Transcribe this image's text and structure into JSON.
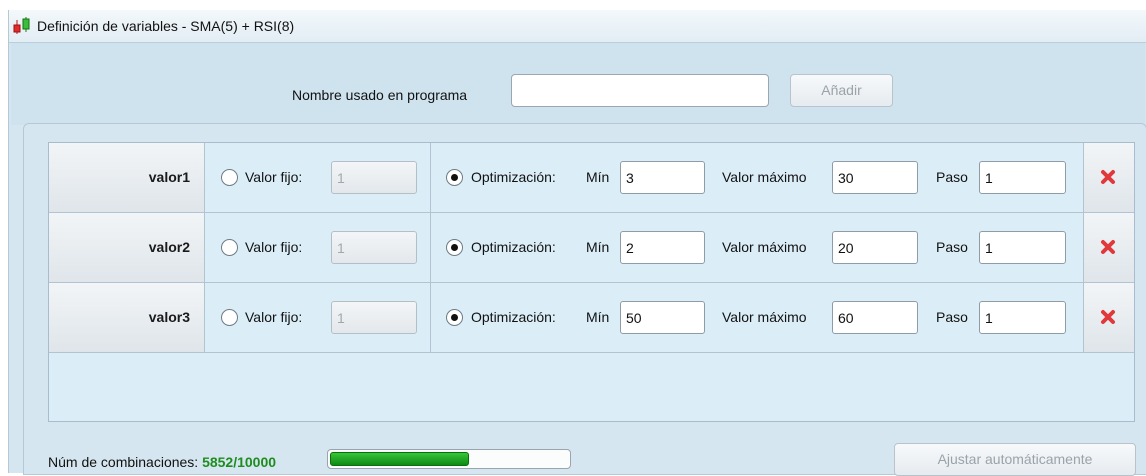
{
  "window": {
    "title": "Definición de variables - SMA(5) + RSI(8)"
  },
  "topbar": {
    "name_label": "Nombre usado en programa",
    "name_value": "",
    "add_button": "Añadir"
  },
  "variables": [
    {
      "name": "valor1",
      "fixed_label": "Valor fijo:",
      "fixed_value": "1",
      "mode": "optimization",
      "opt_label": "Optimización:",
      "min_label": "Mín",
      "min": "3",
      "max_label": "Valor máximo",
      "max": "30",
      "step_label": "Paso",
      "step": "1"
    },
    {
      "name": "valor2",
      "fixed_label": "Valor fijo:",
      "fixed_value": "1",
      "mode": "optimization",
      "opt_label": "Optimización:",
      "min_label": "Mín",
      "min": "2",
      "max_label": "Valor máximo",
      "max": "20",
      "step_label": "Paso",
      "step": "1"
    },
    {
      "name": "valor3",
      "fixed_label": "Valor fijo:",
      "fixed_value": "1",
      "mode": "optimization",
      "opt_label": "Optimización:",
      "min_label": "Mín",
      "min": "50",
      "max_label": "Valor máximo",
      "max": "60",
      "step_label": "Paso",
      "step": "1"
    }
  ],
  "footer": {
    "combinations_label": "Núm de combinaciones:",
    "combinations_value": "5852/10000",
    "progress_fraction": 0.5852,
    "auto_adjust_button": "Ajustar automáticamente"
  },
  "colors": {
    "delete_icon": "#e0383b",
    "progress": "#1fa51f",
    "combinations_text": "#1f8c1f"
  },
  "icons": {
    "app": "candlestick-icon",
    "delete": "delete-x-icon"
  }
}
